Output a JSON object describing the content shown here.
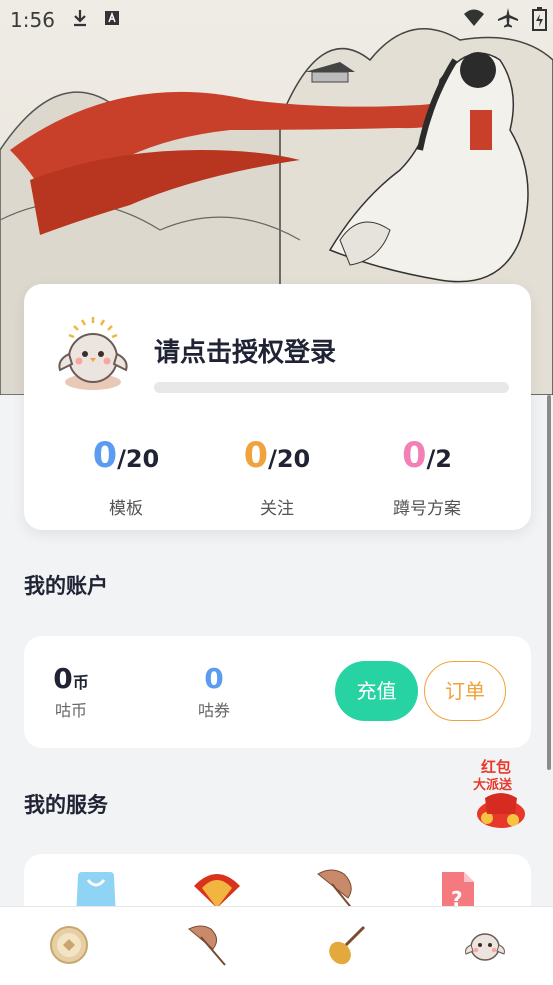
{
  "status_bar": {
    "time": "1:56"
  },
  "profile": {
    "login_prompt": "请点击授权登录",
    "stats": [
      {
        "value": "0",
        "total": "/20",
        "label": "模板",
        "color": "#5b9cf0"
      },
      {
        "value": "0",
        "total": "/20",
        "label": "关注",
        "color": "#f0a23c"
      },
      {
        "value": "0",
        "total": "/2",
        "label": "蹲号方案",
        "color": "#f27fb6"
      }
    ]
  },
  "account": {
    "title": "我的账户",
    "coins": {
      "value": "0",
      "unit": "币",
      "label": "咕币"
    },
    "vouchers": {
      "value": "0",
      "label": "咕券",
      "color": "#5b9cf0"
    },
    "recharge_label": "充值",
    "order_label": "订单"
  },
  "services": {
    "title": "我的服务",
    "icons": [
      "shopping-bag-icon",
      "fan-icon",
      "umbrella-icon",
      "help-document-icon"
    ]
  },
  "red_packet": {
    "line1": "红包",
    "line2": "大派送"
  },
  "bottom_nav": [
    "coin-home-icon",
    "umbrella-icon",
    "pipa-icon",
    "owl-mascot-icon"
  ],
  "colors": {
    "accent_green": "#27d3a2",
    "accent_orange": "#f0a23c",
    "blue": "#5b9cf0",
    "pink": "#f27fb6"
  }
}
